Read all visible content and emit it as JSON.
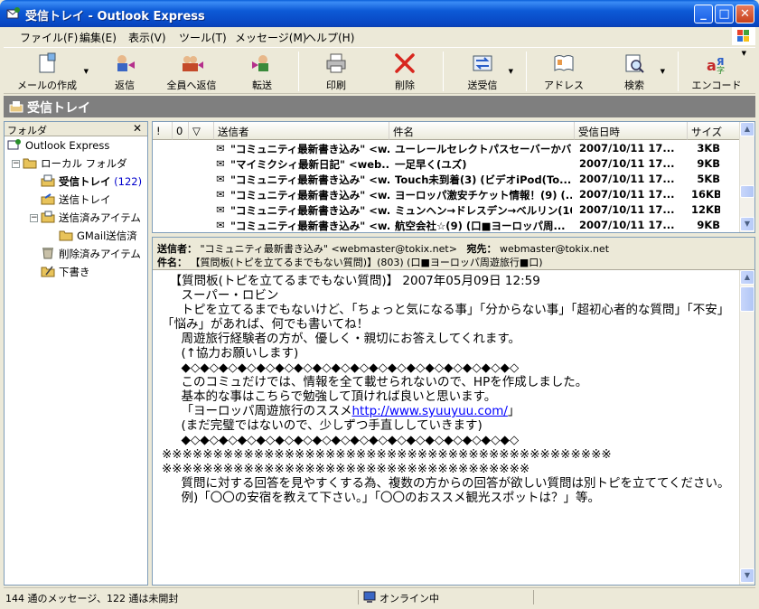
{
  "window": {
    "title": "受信トレイ - Outlook Express",
    "minimize_glyph": "_",
    "maximize_glyph": "□",
    "close_glyph": "✕"
  },
  "menu": [
    "ファイル(F)",
    "編集(E)",
    "表示(V)",
    "ツール(T)",
    "メッセージ(M)",
    "ヘルプ(H)"
  ],
  "toolbar": {
    "new_mail": "メールの作成",
    "reply": "返信",
    "reply_all": "全員へ返信",
    "forward": "転送",
    "print": "印刷",
    "delete": "削除",
    "send_receive": "送受信",
    "addresses": "アドレス",
    "find": "検索",
    "encoding": "エンコード"
  },
  "current_folder": "受信トレイ",
  "folders": {
    "header": "フォルダ",
    "close": "✕",
    "items": [
      {
        "label": "Outlook Express"
      },
      {
        "label": "ローカル フォルダ"
      },
      {
        "label": "受信トレイ",
        "count": "(122)"
      },
      {
        "label": "送信トレイ"
      },
      {
        "label": "送信済みアイテム"
      },
      {
        "label": "GMail送信済"
      },
      {
        "label": "削除済みアイテム"
      },
      {
        "label": "下書き"
      }
    ]
  },
  "list": {
    "columns": {
      "importance": "!",
      "attachment": "0",
      "flag": "▽",
      "from": "送信者",
      "subject": "件名",
      "received": "受信日時",
      "size": "サイズ"
    },
    "rows": [
      {
        "from": "\"コミュニティ最新書き込み\" <w...",
        "subject": "ユーレールセレクトパスセーバーかバ...",
        "date": "2007/10/11 17...",
        "size": "3KB"
      },
      {
        "from": "\"マイミクシィ最新日記\" <web...",
        "subject": "一足早く(ユズ)",
        "date": "2007/10/11 17...",
        "size": "9KB"
      },
      {
        "from": "\"コミュニティ最新書き込み\" <w...",
        "subject": "Touch未到着(3) (ビデオiPod(To...",
        "date": "2007/10/11 17...",
        "size": "5KB"
      },
      {
        "from": "\"コミュニティ最新書き込み\" <w...",
        "subject": "ヨーロッパ激安チケット情報！(9) (...",
        "date": "2007/10/11 17...",
        "size": "16KB"
      },
      {
        "from": "\"コミュニティ最新書き込み\" <w...",
        "subject": "ミュンヘン→ドレスデン→ベルリン(10...",
        "date": "2007/10/11 17...",
        "size": "12KB"
      },
      {
        "from": "\"コミュニティ最新書き込み\" <w...",
        "subject": "航空会社☆(9) (口■ヨーロッパ周...",
        "date": "2007/10/11 17...",
        "size": "9KB"
      }
    ]
  },
  "preview": {
    "from_label": "送信者：",
    "from_value": "\"コミュニティ最新書き込み\" <webmaster@tokix.net>",
    "to_label": "宛先：",
    "to_value": "webmaster@tokix.net",
    "subject_label": "件名：",
    "subject_value": "【質問板(トピを立てるまでもない質問)】(803) (口■ヨーロッパ周遊旅行■口)",
    "body": [
      "  【質問板(トピを立てるまでもない質問)】 2007年05月09日 12:59",
      "     スーパー・ロビン",
      "     トピを立てるまでもないけど、「ちょっと気になる事」「分からない事」「超初心者的な質問」「不安」",
      "「悩み」があれば、何でも書いてね！",
      "",
      "     周遊旅行経験者の方が、優しく・親切にお答えしてくれます。",
      "     (↑協力お願いします)",
      "",
      "     ◆◇◆◇◆◇◆◇◆◇◆◇◆◇◆◇◆◇◆◇◆◇◆◇◆◇◆◇◆◇◆◇◆◇◆◇",
      "     このコミュだけでは、情報を全て載せられないので、HPを作成しました。",
      "     基本的な事はこちらで勉強して頂ければ良いと思います。",
      "     「ヨーロッパ周遊旅行のススメ",
      "     (まだ完璧ではないので、少しずつ手直ししていきます)",
      "     ◆◇◆◇◆◇◆◇◆◇◆◇◆◇◆◇◆◇◆◇◆◇◆◇◆◇◆◇◆◇◆◇◆◇◆◇",
      "",
      "",
      "",
      "※※※※※※※※※※※※※※※※※※※※※※※※※※※※※※※※※※※※※※※※※※※※",
      "※※※※※※※※※※※※※※※※※※※※※※※※※※※※※※※※※※※※",
      "     質問に対する回答を見やすくする為、複数の方からの回答が欲しい質問は別トピを立ててください。",
      "     例)「〇〇の安宿を教えて下さい。」「〇〇のおススメ観光スポットは？」等。"
    ],
    "link": "http://www.syuuyuu.com/",
    "link_suffix": "」"
  },
  "status": {
    "messages": "144 通のメッセージ、122 通は未開封",
    "connection": "オンライン中"
  },
  "colors": {
    "titlebar": "#0a4fd0",
    "folderbar": "#7f7f7f",
    "link": "#0000ff"
  }
}
